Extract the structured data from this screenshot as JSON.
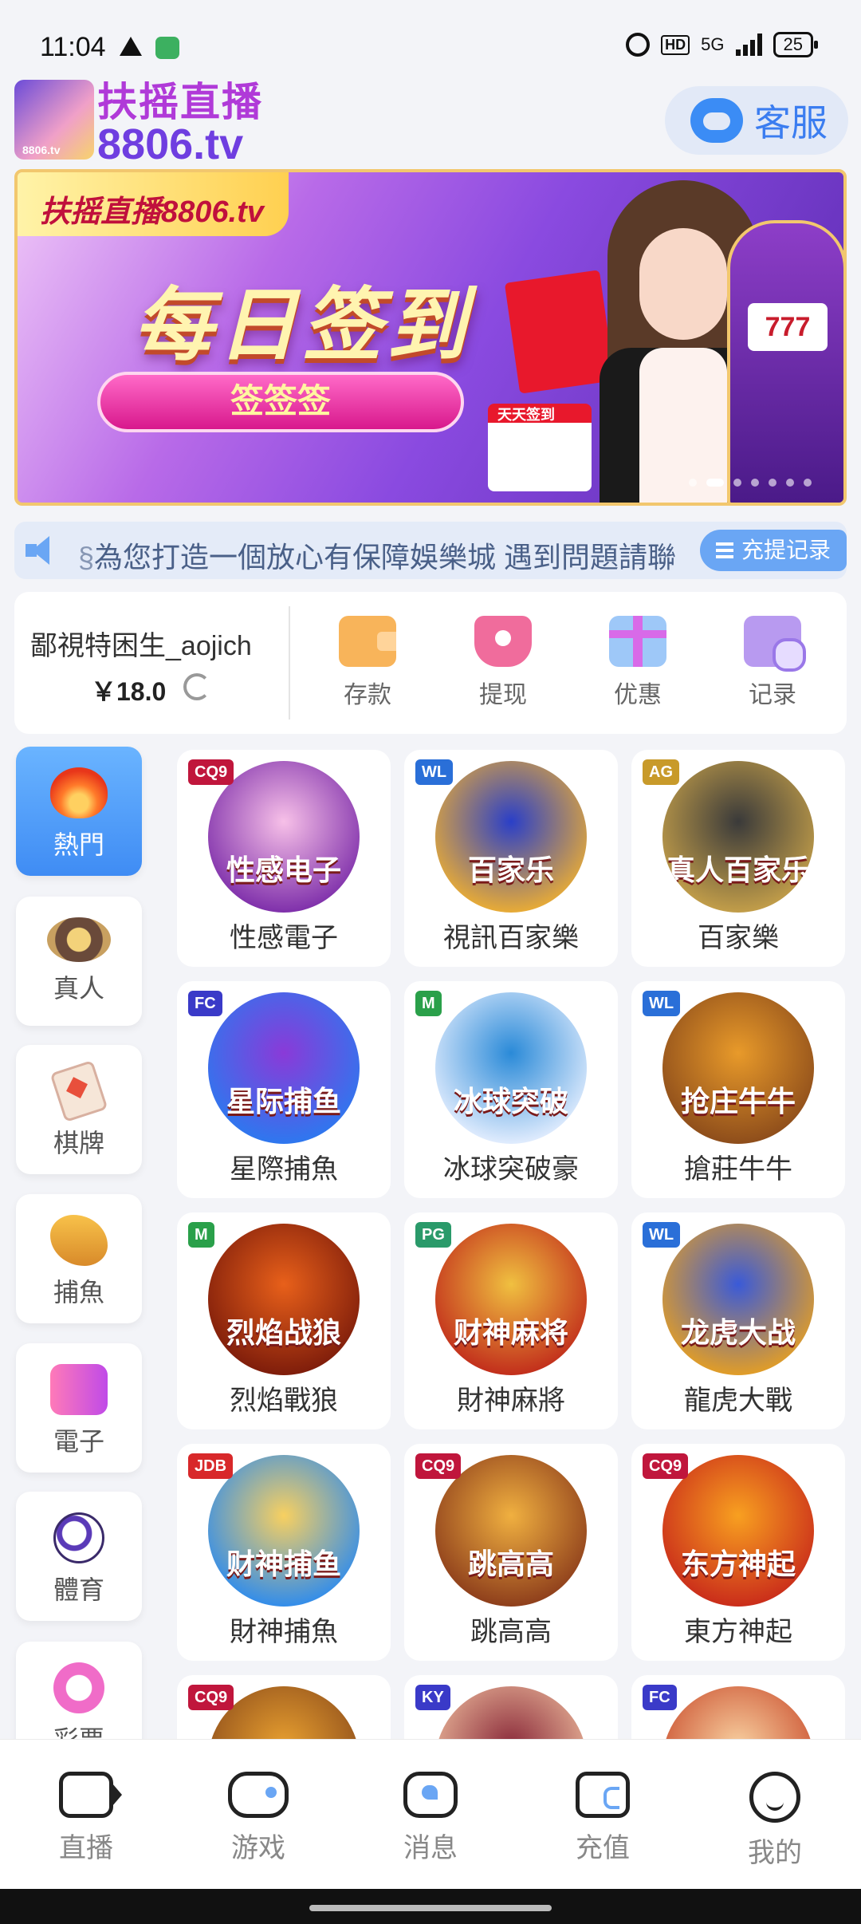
{
  "status_bar": {
    "time": "11:04",
    "network": "5G",
    "hd": "HD",
    "battery": "25"
  },
  "header": {
    "logo_line1": "扶摇直播",
    "logo_line2": "8806.tv",
    "logo_small": "8806.tv",
    "service_label": "客服"
  },
  "banner": {
    "tag": "扶摇直播8806.tv",
    "headline": "每日签到",
    "button": "签签签",
    "calendar": "天天签到",
    "slot_text": "777",
    "slide_count": 7,
    "active_slide": 1
  },
  "marquee": {
    "text": "為您打造一個放心有保障娛樂城  遇到問題請聯",
    "prefix": "§",
    "record_button": "充提记录"
  },
  "user": {
    "username": "鄙視特困生_aojich",
    "balance": "￥18.0",
    "actions": [
      {
        "label": "存款",
        "icon": "wallet-icon"
      },
      {
        "label": "提现",
        "icon": "withdraw-icon"
      },
      {
        "label": "优惠",
        "icon": "gift-icon"
      },
      {
        "label": "记录",
        "icon": "records-folder-icon"
      }
    ]
  },
  "categories": [
    {
      "label": "熱門",
      "icon": "fire-icon",
      "active": true
    },
    {
      "label": "真人",
      "icon": "casino-chip-icon",
      "active": false
    },
    {
      "label": "棋牌",
      "icon": "playing-card-icon",
      "active": false
    },
    {
      "label": "捕魚",
      "icon": "shark-icon",
      "active": false
    },
    {
      "label": "電子",
      "icon": "slot-777-icon",
      "active": false
    },
    {
      "label": "體育",
      "icon": "soccer-ball-icon",
      "active": false
    },
    {
      "label": "彩票",
      "icon": "lottery-ball-icon",
      "active": false
    }
  ],
  "games": [
    {
      "label": "性感電子",
      "art_text": "性感电子",
      "badge": "CQ9",
      "badge_color": "#c0163c",
      "colors": [
        "#f7c0e8",
        "#7a2aa8"
      ]
    },
    {
      "label": "視訊百家樂",
      "art_text": "百家乐",
      "badge": "WL",
      "badge_color": "#2a6fd8",
      "colors": [
        "#2a3fc8",
        "#f0b030"
      ]
    },
    {
      "label": "百家樂",
      "art_text": "真人百家乐",
      "badge": "AG",
      "badge_color": "#c89a2a",
      "colors": [
        "#3a3a3a",
        "#c8a24a"
      ]
    },
    {
      "label": "星際捕魚",
      "art_text": "星际捕鱼",
      "badge": "FC",
      "badge_color": "#3a3ac8",
      "colors": [
        "#8a3ad8",
        "#2a7af0"
      ]
    },
    {
      "label": "冰球突破豪",
      "art_text": "冰球突破",
      "badge": "M",
      "badge_color": "#2aa04a",
      "colors": [
        "#2a8ad8",
        "#e8f0ff"
      ]
    },
    {
      "label": "搶莊牛牛",
      "art_text": "抢庄牛牛",
      "badge": "WL",
      "badge_color": "#2a6fd8",
      "colors": [
        "#e89a2a",
        "#8a4a1a"
      ]
    },
    {
      "label": "烈焰戰狼",
      "art_text": "烈焰战狼",
      "badge": "M",
      "badge_color": "#2aa04a",
      "colors": [
        "#e8601a",
        "#7a1a0a"
      ]
    },
    {
      "label": "財神麻將",
      "art_text": "财神麻将",
      "badge": "PG",
      "badge_color": "#2a9a6a",
      "colors": [
        "#f0c040",
        "#c0281a"
      ]
    },
    {
      "label": "龍虎大戰",
      "art_text": "龙虎大战",
      "badge": "WL",
      "badge_color": "#2a6fd8",
      "colors": [
        "#3a5ad8",
        "#e8a020"
      ]
    },
    {
      "label": "財神捕魚",
      "art_text": "财神捕鱼",
      "badge": "JDB",
      "badge_color": "#d8282a",
      "colors": [
        "#f8d060",
        "#2a8af0"
      ]
    },
    {
      "label": "跳高高",
      "art_text": "跳高高",
      "badge": "CQ9",
      "badge_color": "#c0163c",
      "colors": [
        "#f0b040",
        "#8a3a1a"
      ]
    },
    {
      "label": "東方神起",
      "art_text": "东方神起",
      "badge": "CQ9",
      "badge_color": "#c0163c",
      "colors": [
        "#f8a020",
        "#c8281a"
      ]
    },
    {
      "label": "",
      "art_text": "",
      "badge": "CQ9",
      "badge_color": "#c0163c",
      "colors": [
        "#e8a030",
        "#8a4a1a"
      ]
    },
    {
      "label": "",
      "art_text": "",
      "badge": "KY",
      "badge_color": "#3a3ac8",
      "colors": [
        "#8a2a3a",
        "#f0c0a0"
      ]
    },
    {
      "label": "",
      "art_text": "",
      "badge": "FC",
      "badge_color": "#3a3ac8",
      "colors": [
        "#f8d0a0",
        "#c84a2a"
      ]
    }
  ],
  "bottom_nav": [
    {
      "label": "直播",
      "icon": "live-camera-icon"
    },
    {
      "label": "游戏",
      "icon": "gamepad-icon"
    },
    {
      "label": "消息",
      "icon": "message-icon"
    },
    {
      "label": "充值",
      "icon": "wallet-topup-icon"
    },
    {
      "label": "我的",
      "icon": "profile-smile-icon"
    }
  ]
}
